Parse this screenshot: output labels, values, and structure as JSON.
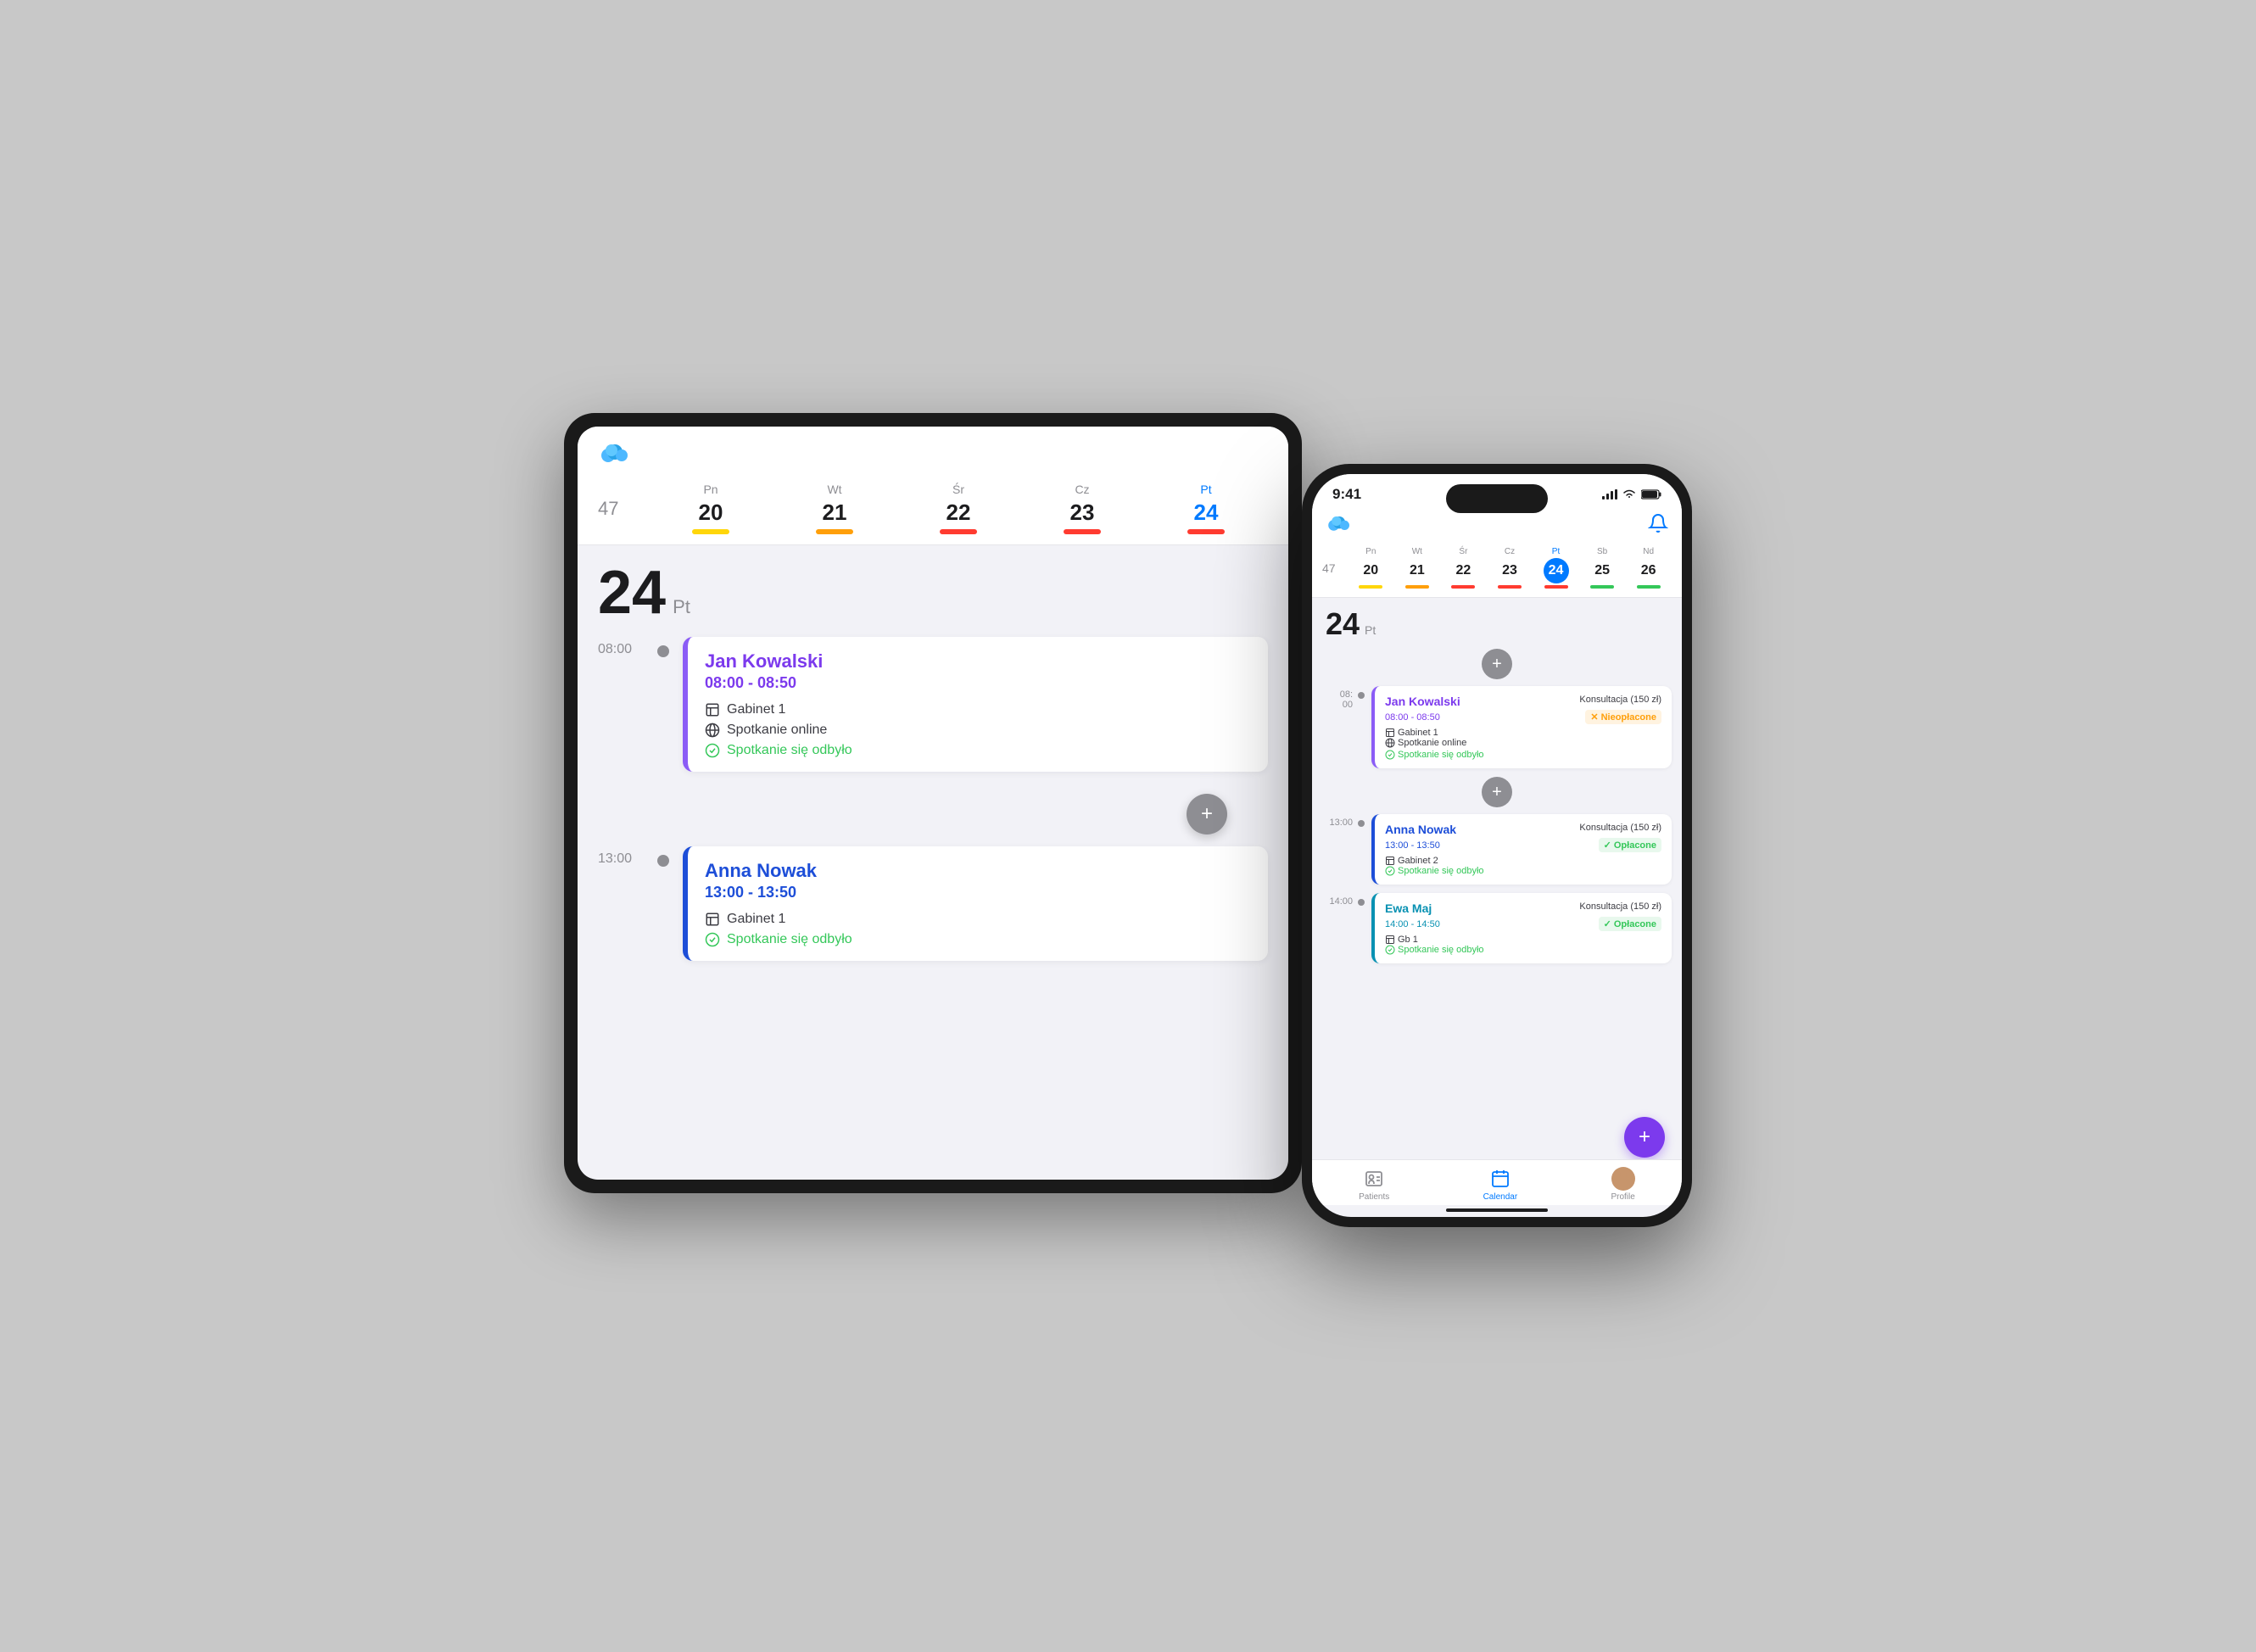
{
  "scene": {
    "bg": "#c8c8c8"
  },
  "tablet": {
    "logo_alt": "app logo",
    "week_num": "47",
    "days": [
      {
        "name": "Pn",
        "num": "20",
        "bar_color": "yellow",
        "active": false
      },
      {
        "name": "Wt",
        "num": "21",
        "bar_color": "orange",
        "active": false
      },
      {
        "name": "Śr",
        "num": "22",
        "bar_color": "red",
        "active": false
      },
      {
        "name": "Cz",
        "num": "23",
        "bar_color": "red",
        "active": false
      },
      {
        "name": "Pt",
        "num": "24",
        "bar_color": "red",
        "active": true
      }
    ],
    "current_day": "24",
    "current_day_label": "Pt",
    "appointments": [
      {
        "time": "08:00",
        "name": "Jan Kowalski",
        "time_range": "08:00 - 08:50",
        "location": "Gabinet 1",
        "online": "Spotkanie online",
        "status": "Spotkanie się odbyło",
        "color": "purple"
      },
      {
        "time": "13:00",
        "name": "Anna Nowak",
        "time_range": "13:00 - 13:50",
        "location": "Gabinet 1",
        "status": "Spotkanie się odbyło",
        "color": "blue"
      }
    ]
  },
  "phone": {
    "status_time": "9:41",
    "week_num": "47",
    "days": [
      {
        "name": "Pn",
        "num": "20",
        "bar_color": "yellow",
        "active": false
      },
      {
        "name": "Wt",
        "num": "21",
        "bar_color": "orange",
        "active": false
      },
      {
        "name": "Śr",
        "num": "22",
        "bar_color": "red",
        "active": false
      },
      {
        "name": "Cz",
        "num": "23",
        "bar_color": "red",
        "active": false
      },
      {
        "name": "Pt",
        "num": "24",
        "bar_color": "red",
        "active": true
      },
      {
        "name": "Sb",
        "num": "25",
        "bar_color": "green",
        "active": false
      },
      {
        "name": "Nd",
        "num": "26",
        "bar_color": "green",
        "active": false
      }
    ],
    "current_day": "24",
    "current_day_label": "Pt",
    "appointments": [
      {
        "time": "08:00",
        "name": "Jan Kowalski",
        "time_range": "08:00 - 08:50",
        "konsultacja": "Konsultacja (150 zł)",
        "location": "Gabinet 1",
        "payment": "Nieopłacone",
        "payment_type": "unpaid",
        "online": "Spotkanie online",
        "status": "Spotkanie się odbyło",
        "color": "purple"
      },
      {
        "time": "13:00",
        "name": "Anna Nowak",
        "time_range": "13:00 - 13:50",
        "konsultacja": "Konsultacja (150 zł)",
        "location": "Gabinet 2",
        "payment": "Opłacone",
        "payment_type": "paid",
        "status": "Spotkanie się odbyło",
        "color": "blue"
      },
      {
        "time": "14:00",
        "name": "Ewa Maj",
        "time_range": "14:00 - 14:50",
        "konsultacja": "Konsultacja (150 zł)",
        "location": "Gb 1",
        "payment": "Opłacone",
        "payment_type": "paid",
        "status": "Spotkanie się odbyło",
        "color": "teal"
      }
    ],
    "tabs": [
      {
        "label": "Patients",
        "icon": "person-card",
        "active": false
      },
      {
        "label": "Calendar",
        "icon": "calendar",
        "active": true
      },
      {
        "label": "Profile",
        "icon": "avatar",
        "active": false
      }
    ]
  }
}
